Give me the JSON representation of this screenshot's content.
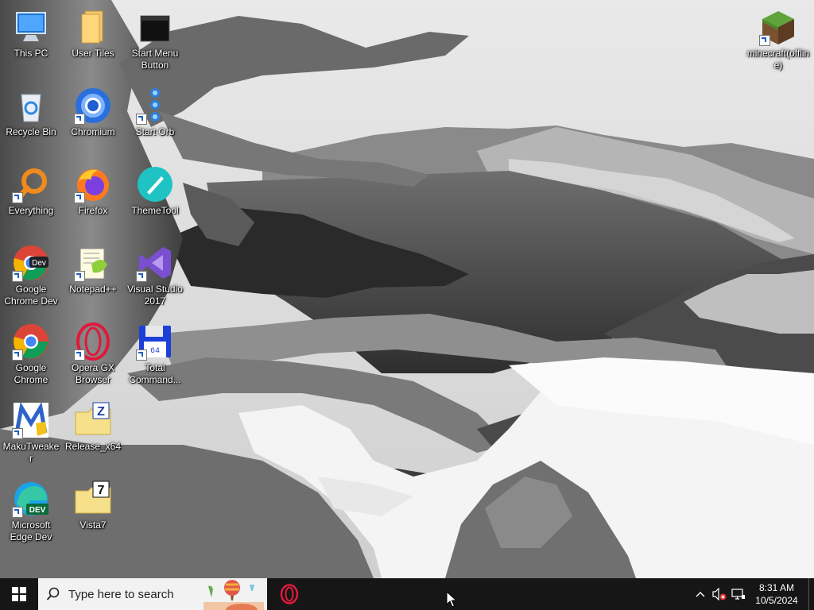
{
  "desktop": {
    "icons": [
      {
        "label": "This PC",
        "icon": "this-pc-icon"
      },
      {
        "label": "User Tiles",
        "icon": "folder-icon"
      },
      {
        "label": "Start Menu Button",
        "icon": "black-square-icon"
      },
      {
        "label": "minecraft(offline)",
        "icon": "minecraft-grass-block-icon"
      },
      {
        "label": "Recycle Bin",
        "icon": "recycle-bin-icon"
      },
      {
        "label": "Chromium",
        "icon": "chromium-icon"
      },
      {
        "label": "Start Orb",
        "icon": "start-orb-icon"
      },
      {
        "label": "Everything",
        "icon": "everything-search-icon"
      },
      {
        "label": "Firefox",
        "icon": "firefox-icon"
      },
      {
        "label": "ThemeTool",
        "icon": "themetool-icon"
      },
      {
        "label": "Google Chrome Dev",
        "icon": "chrome-dev-icon"
      },
      {
        "label": "Notepad++",
        "icon": "notepad-plus-plus-icon"
      },
      {
        "label": "Visual Studio 2017",
        "icon": "visual-studio-icon"
      },
      {
        "label": "Google Chrome",
        "icon": "chrome-icon"
      },
      {
        "label": "Opera GX Browser",
        "icon": "opera-gx-icon"
      },
      {
        "label": "Total Command...",
        "icon": "total-commander-icon"
      },
      {
        "label": "MakuTweaker",
        "icon": "makutweaker-icon"
      },
      {
        "label": "Release_x64",
        "icon": "zip-folder-icon"
      },
      {
        "label": "Microsoft Edge Dev",
        "icon": "edge-dev-icon"
      },
      {
        "label": "Vista7",
        "icon": "7z-folder-icon"
      }
    ]
  },
  "taskbar": {
    "start_icon": "windows-logo-icon",
    "search_placeholder": "Type here to search",
    "pinned": [
      {
        "name": "Opera GX",
        "icon": "opera-gx-icon"
      }
    ],
    "tray": {
      "icons": [
        "chevron-up-icon",
        "speaker-muted-icon",
        "network-icon"
      ],
      "time": "8:31 AM",
      "date": "10/5/2024"
    }
  },
  "colors": {
    "taskbar": "#161616",
    "search_bg": "#f2f2f2",
    "label_text": "#ffffff"
  }
}
